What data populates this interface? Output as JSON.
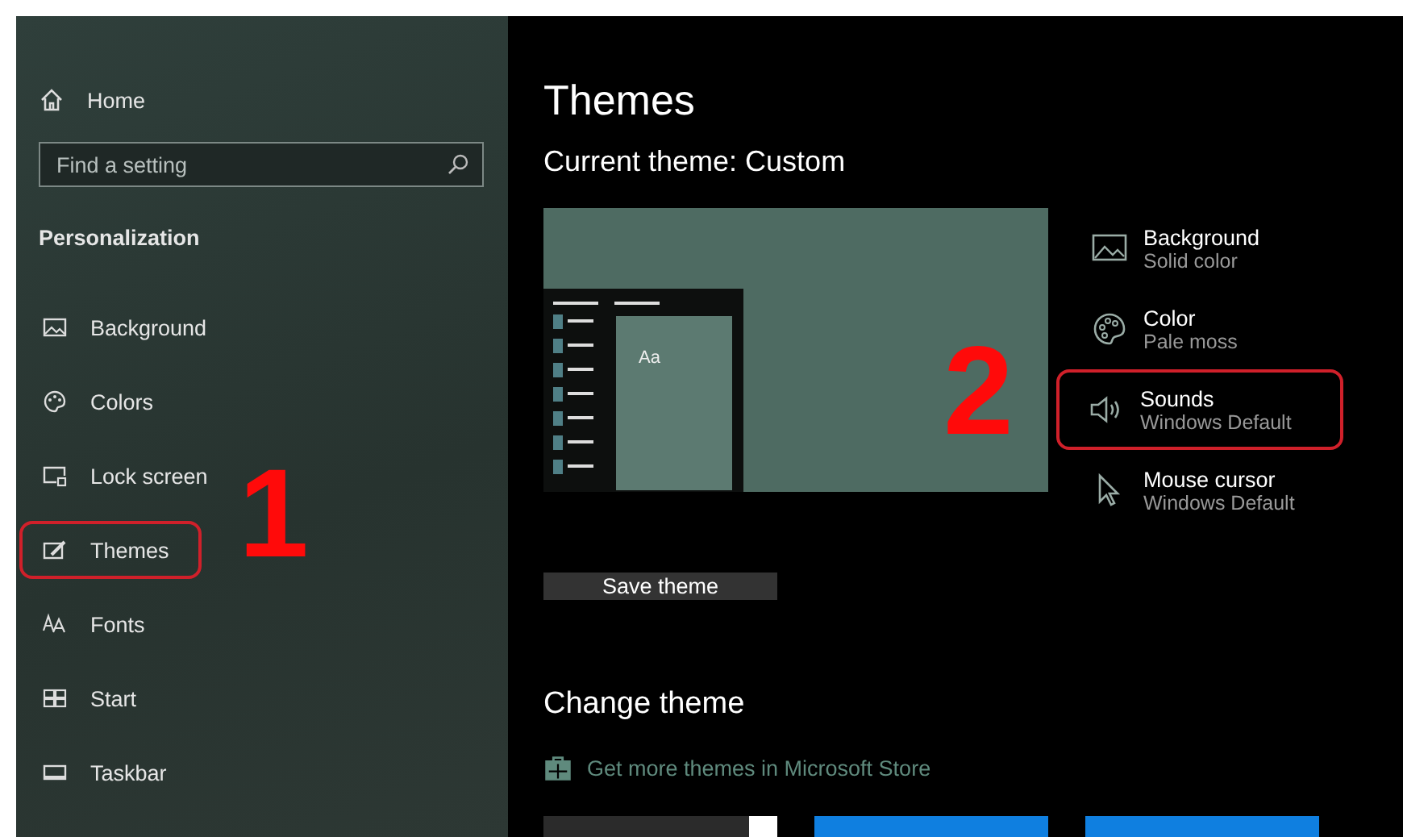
{
  "sidebar": {
    "home": "Home",
    "search": {
      "placeholder": "Find a setting"
    },
    "section": "Personalization",
    "items": [
      {
        "label": "Background",
        "highlighted": false
      },
      {
        "label": "Colors",
        "highlighted": false
      },
      {
        "label": "Lock screen",
        "highlighted": false
      },
      {
        "label": "Themes",
        "highlighted": true,
        "callout": "1"
      },
      {
        "label": "Fonts",
        "highlighted": false
      },
      {
        "label": "Start",
        "highlighted": false
      },
      {
        "label": "Taskbar",
        "highlighted": false
      }
    ]
  },
  "main": {
    "title": "Themes",
    "current_theme": "Current theme: Custom",
    "preview_text": "Aa",
    "theme_settings": [
      {
        "name": "Background",
        "value": "Solid color",
        "highlighted": false
      },
      {
        "name": "Color",
        "value": "Pale moss",
        "highlighted": false
      },
      {
        "name": "Sounds",
        "value": "Windows Default",
        "highlighted": true,
        "callout": "2"
      },
      {
        "name": "Mouse cursor",
        "value": "Windows Default",
        "highlighted": false
      }
    ],
    "save_button": "Save theme",
    "change_title": "Change theme",
    "store_link": "Get more themes in Microsoft Store",
    "theme_tiles": [
      {
        "kind": "dark"
      },
      {
        "kind": "blue"
      },
      {
        "kind": "blue"
      }
    ]
  }
}
